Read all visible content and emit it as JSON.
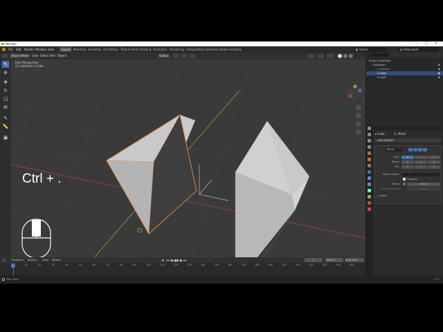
{
  "window": {
    "title": "Blender",
    "controls": [
      "—",
      "☐",
      "✕"
    ]
  },
  "menu": {
    "items": [
      "File",
      "Edit",
      "Render",
      "Window",
      "Help"
    ]
  },
  "workspaces": [
    "Layout",
    "Modeling",
    "Sculpting",
    "UV Editing",
    "Texture Paint",
    "Shading",
    "Animation",
    "Rendering",
    "Compositing",
    "Geometry Nodes",
    "Scripting"
  ],
  "active_workspace": "Layout",
  "scene": {
    "label": "Scene",
    "view_layer": "View Layer"
  },
  "viewport_header": {
    "mode": "Object Mode",
    "menus": [
      "View",
      "Select",
      "Add",
      "Object"
    ],
    "transform": "Global",
    "options": "Options"
  },
  "viewport": {
    "line1": "User Perspective",
    "line2": "(1) Collection | Cube",
    "shortcut": "Ctrl + ."
  },
  "outliner": {
    "rows": [
      {
        "label": "Scene Collection",
        "indent": 0,
        "selected": false
      },
      {
        "label": "Collection",
        "indent": 1,
        "selected": false
      },
      {
        "label": "Camera",
        "indent": 2,
        "selected": false
      },
      {
        "label": "Cube",
        "indent": 2,
        "selected": true
      },
      {
        "label": "Light",
        "indent": 2,
        "selected": false
      }
    ]
  },
  "properties": {
    "object_name": "Cube",
    "modifier_context": "Mirror",
    "add_modifier": "Add Modifier",
    "modifier_name": "Mirror",
    "rows": {
      "axis": "Axis",
      "bisect": "Bisect",
      "flip": "Flip",
      "mirror_object": "Mirror Object",
      "clipping": "Clipping",
      "merge": "Merge",
      "merge_value": "0.001 m",
      "bisect_distance": "Bisect Distance",
      "bisect_distance_value": "0.001 m",
      "data": "Data"
    },
    "axis_buttons": [
      "X",
      "Y",
      "Z"
    ]
  },
  "timeline": {
    "menus": [
      "Playback",
      "Keying",
      "View",
      "Marker"
    ],
    "current_frame": "1",
    "start_label": "Start",
    "start": "1",
    "end_label": "End",
    "end": "250",
    "ruler": [
      "0",
      "10",
      "20",
      "30",
      "40",
      "50",
      "60",
      "70",
      "80",
      "90",
      "100",
      "110",
      "120",
      "130",
      "140",
      "150",
      "160",
      "170",
      "180",
      "190",
      "200",
      "210",
      "220",
      "230",
      "240",
      "250"
    ]
  },
  "status": {
    "left": "Pan View",
    "version": "3.2.1"
  },
  "colors": {
    "accent": "#4772b3",
    "selection_outline": "#e8903a",
    "viewport_bg": "#3a3a3a",
    "x_axis": "#a8404c",
    "y_axis": "#8aa83c"
  },
  "icons": [
    "blender-logo-icon",
    "search-icon",
    "eye-icon",
    "camera-icon",
    "cube-icon",
    "light-icon",
    "wrench-icon"
  ]
}
